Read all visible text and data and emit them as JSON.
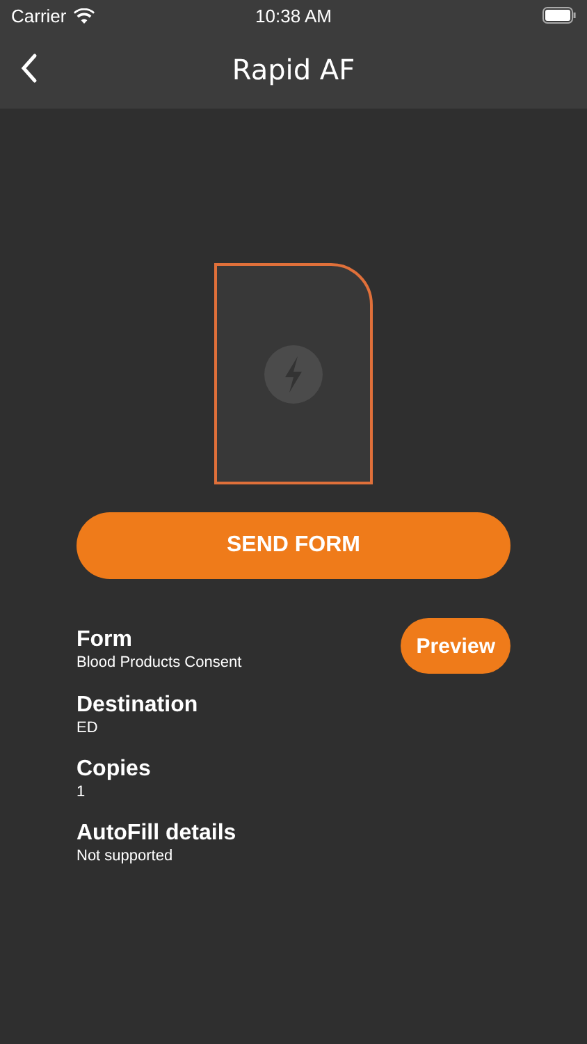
{
  "status_bar": {
    "carrier": "Carrier",
    "time": "10:38 AM"
  },
  "nav": {
    "title": "Rapid AF"
  },
  "send_button": "SEND FORM",
  "details": [
    {
      "label": "Form",
      "value": "Blood Products Consent",
      "action": "Preview"
    },
    {
      "label": "Destination",
      "value": "ED"
    },
    {
      "label": "Copies",
      "value": "1"
    },
    {
      "label": "AutoFill details",
      "value": "Not supported"
    }
  ]
}
